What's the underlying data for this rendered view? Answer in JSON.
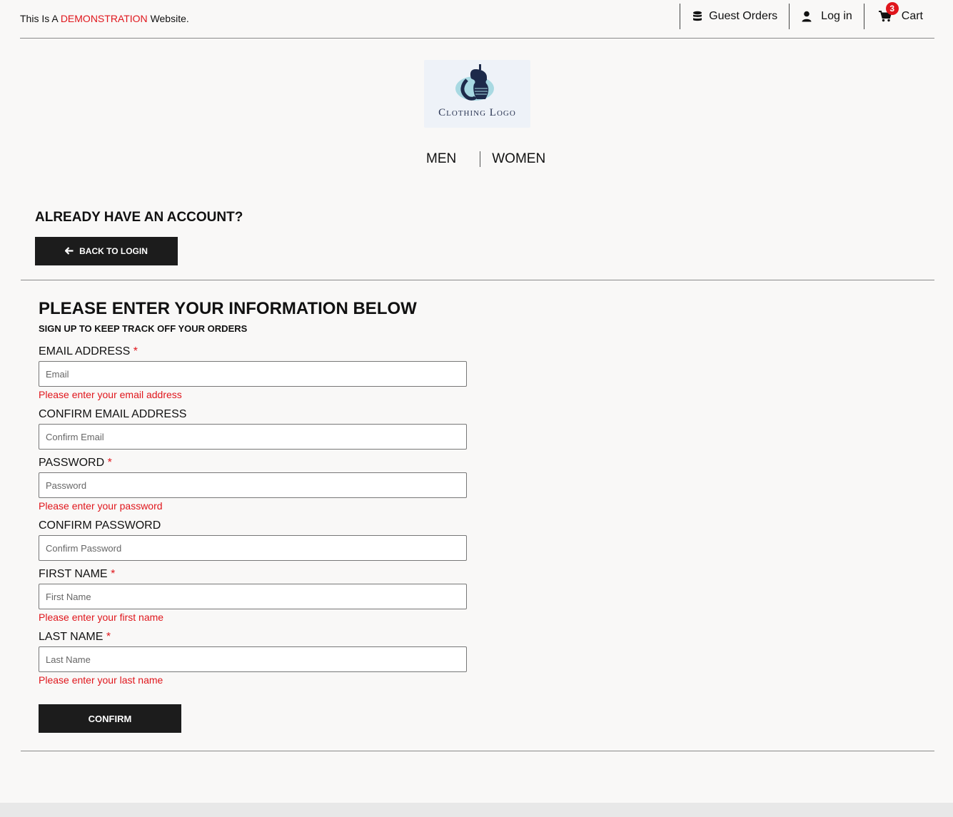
{
  "topbar": {
    "demo_prefix": "This Is A",
    "demo_highlight": "DEMONSTRATION",
    "demo_suffix": "Website.",
    "guest_orders": "Guest Orders",
    "login": "Log in",
    "cart": "Cart",
    "cart_count": "3"
  },
  "logo": {
    "text": "Clothing Logo"
  },
  "nav": {
    "men": "MEN",
    "women": "WOMEN"
  },
  "account": {
    "heading": "ALREADY HAVE AN ACCOUNT?",
    "back_button": "BACK TO LOGIN"
  },
  "form": {
    "title": "PLEASE ENTER YOUR INFORMATION BELOW",
    "subtitle": "SIGN UP TO KEEP TRACK OFF YOUR ORDERS",
    "required_marker": "*",
    "email": {
      "label": "EMAIL ADDRESS",
      "placeholder": "Email",
      "value": "",
      "error": "Please enter your email address"
    },
    "confirm_email": {
      "label": "CONFIRM EMAIL ADDRESS",
      "placeholder": "Confirm Email",
      "value": ""
    },
    "password": {
      "label": "PASSWORD",
      "placeholder": "Password",
      "value": "",
      "error": "Please enter your password"
    },
    "confirm_password": {
      "label": "CONFIRM PASSWORD",
      "placeholder": "Confirm Password",
      "value": ""
    },
    "first_name": {
      "label": "FIRST NAME",
      "placeholder": "First Name",
      "value": "",
      "error": "Please enter your first name"
    },
    "last_name": {
      "label": "LAST NAME",
      "placeholder": "Last Name",
      "value": "",
      "error": "Please enter your last name"
    },
    "confirm_button": "CONFIRM"
  },
  "colors": {
    "accent_red": "#e0161c",
    "button_dark": "#1c1c1c",
    "background": "#f9f8f7"
  },
  "icons": {
    "guest_orders": "database-icon",
    "login": "user-icon",
    "cart": "cart-icon",
    "back": "arrow-left-icon"
  }
}
